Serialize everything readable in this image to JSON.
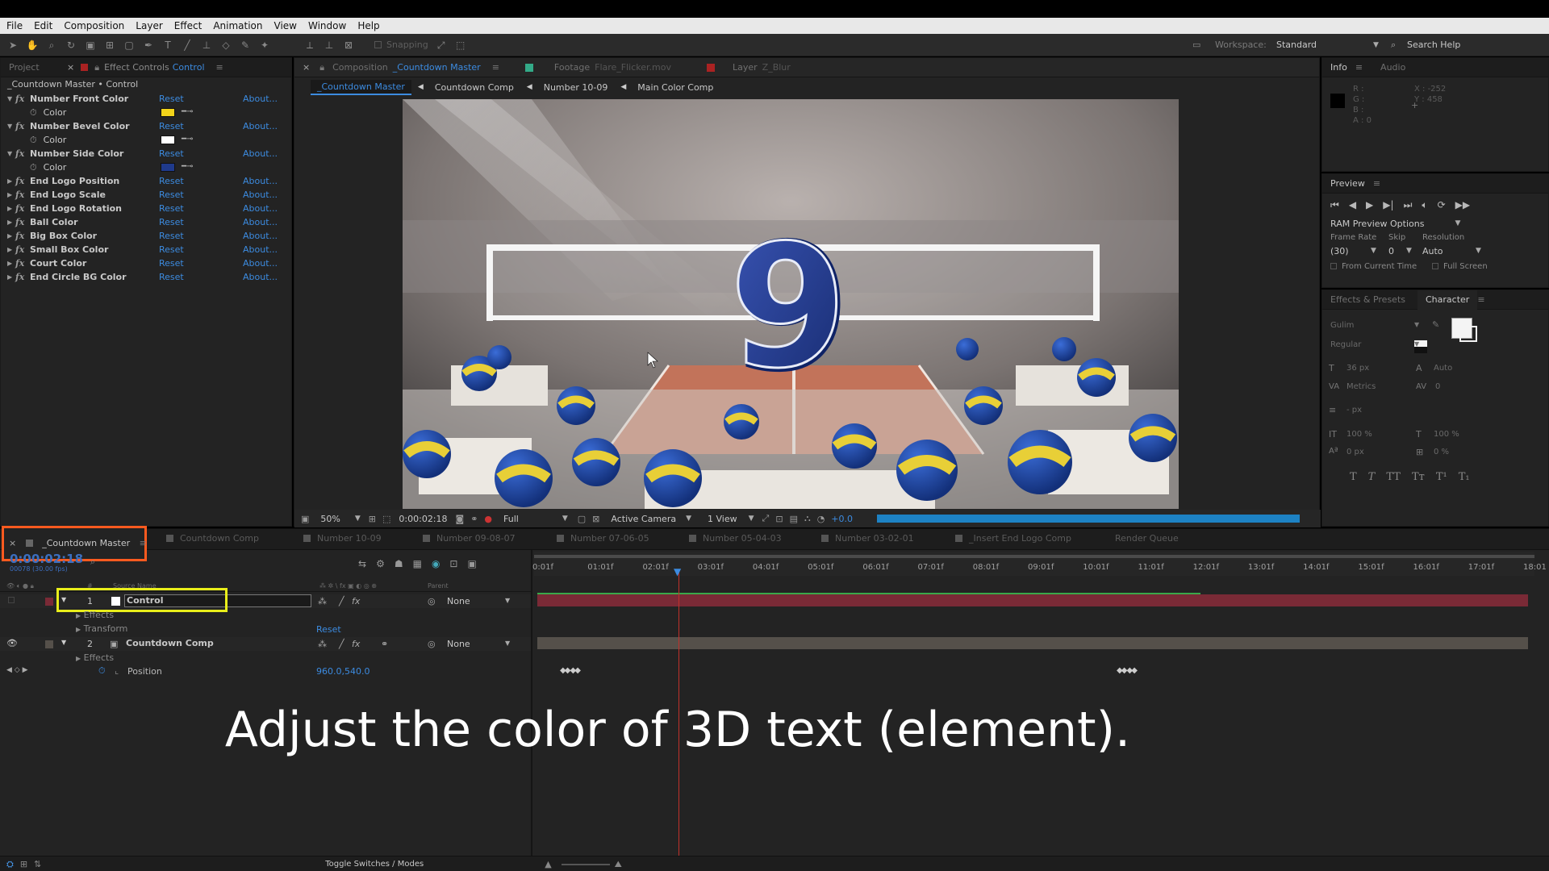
{
  "menu": [
    "File",
    "Edit",
    "Composition",
    "Layer",
    "Effect",
    "Animation",
    "View",
    "Window",
    "Help"
  ],
  "toolbar": {
    "snapping_label": "Snapping",
    "workspace_label": "Workspace:",
    "workspace_value": "Standard",
    "search_help": "Search Help"
  },
  "left_panel": {
    "tab_project": "Project",
    "tab_effect_controls": "Effect Controls",
    "tab_effect_controls_layer": "Control",
    "breadcrumb": "_Countdown Master • Control",
    "reset_label": "Reset",
    "about_label": "About...",
    "color_label": "Color",
    "effects": [
      {
        "name": "Number Front Color",
        "expanded": true,
        "color": "#f2d31a"
      },
      {
        "name": "Number Bevel Color",
        "expanded": true,
        "color": "#ffffff"
      },
      {
        "name": "Number Side Color",
        "expanded": true,
        "color": "#1f3a8c"
      },
      {
        "name": "End Logo Position",
        "expanded": false
      },
      {
        "name": "End Logo Scale",
        "expanded": false
      },
      {
        "name": "End Logo Rotation",
        "expanded": false
      },
      {
        "name": "Ball Color",
        "expanded": false
      },
      {
        "name": "Big Box Color",
        "expanded": false
      },
      {
        "name": "Small Box Color",
        "expanded": false
      },
      {
        "name": "Court Color",
        "expanded": false
      },
      {
        "name": "End Circle BG Color",
        "expanded": false
      }
    ]
  },
  "viewer": {
    "tab_composition": "Composition",
    "tab_composition_name": "_Countdown Master",
    "tab_footage": "Footage",
    "tab_footage_name": "Flare_Flicker.mov",
    "tab_layer": "Layer",
    "tab_layer_name": "Z_Blur",
    "breadcrumbs": [
      "_Countdown Master",
      "Countdown Comp",
      "Number 10-09",
      "Main Color Comp"
    ],
    "preview_number": "9",
    "footer": {
      "zoom": "50%",
      "timecode": "0:00:02:18",
      "resolution": "Full",
      "camera": "Active Camera",
      "views": "1 View",
      "exposure": "+0.0"
    }
  },
  "info_panel": {
    "tab_info": "Info",
    "tab_audio": "Audio",
    "r": "R :",
    "g": "G :",
    "b": "B :",
    "a": "A : 0",
    "x": "X : -252",
    "y": "Y : 458"
  },
  "preview_panel": {
    "title": "Preview",
    "ram_options": "RAM Preview Options",
    "frame_rate_label": "Frame Rate",
    "skip_label": "Skip",
    "resolution_label": "Resolution",
    "frame_rate_value": "(30)",
    "skip_value": "0",
    "resolution_value": "Auto",
    "from_current_time": "From Current Time",
    "full_screen": "Full Screen"
  },
  "character_panel": {
    "tab_effects_presets": "Effects & Presets",
    "tab_character": "Character",
    "font": "Gulim",
    "style": "Regular",
    "size": "36 px",
    "leading": "Auto",
    "kerning": "Metrics",
    "tracking": "0",
    "stroke": "- px",
    "vscale": "100 %",
    "hscale": "100 %",
    "baseline": "0 px",
    "tsume": "0 %"
  },
  "timeline": {
    "tabs": [
      "_Countdown Master",
      "Countdown Comp",
      "Number 10-09",
      "Number 09-08-07",
      "Number 07-06-05",
      "Number 05-04-03",
      "Number 03-02-01",
      "_Insert End Logo Comp",
      "Render Queue"
    ],
    "timecode": "0:00:02:18",
    "fps": "00078 (30.00 fps)",
    "col_source_name": "Source Name",
    "col_parent": "Parent",
    "ruler": [
      "0:01f",
      "01:01f",
      "02:01f",
      "03:01f",
      "04:01f",
      "05:01f",
      "06:01f",
      "07:01f",
      "08:01f",
      "09:01f",
      "10:01f",
      "11:01f",
      "12:01f",
      "13:01f",
      "14:01f",
      "15:01f",
      "16:01f",
      "17:01f",
      "18:01"
    ],
    "layers": [
      {
        "num": "1",
        "name": "Control",
        "parent": "None",
        "children": [
          "Effects",
          "Transform"
        ]
      },
      {
        "num": "2",
        "name": "Countdown Comp",
        "parent": "None",
        "children": [
          "Effects"
        ]
      }
    ],
    "transform_reset": "Reset",
    "position_label": "Position",
    "position_value": "960.0,540.0",
    "toggle_label": "Toggle Switches / Modes"
  },
  "caption": "Adjust the color of 3D text (element).",
  "colors": {
    "accent_blue": "#3c8be0",
    "highlight_orange": "#ff5a1f",
    "highlight_yellow": "#e9ee1a",
    "layer_bar_red": "#7a2a36",
    "layer_bar_tan": "#55504a"
  }
}
